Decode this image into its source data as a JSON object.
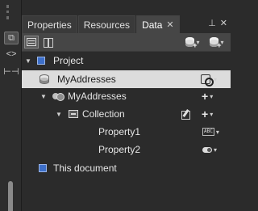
{
  "tabs": [
    {
      "label": "Properties",
      "active": false
    },
    {
      "label": "Resources",
      "active": false
    },
    {
      "label": "Data",
      "active": true
    }
  ],
  "pane_controls": {
    "pin_icon": "pin-icon",
    "close_icon": "close-icon"
  },
  "toolbar": {
    "list_view_icon": "list-view-icon",
    "details_view_icon": "details-view-icon",
    "create_data_source_icon": "database-add-icon",
    "create_sample_data_icon": "database-sample-icon"
  },
  "tree": {
    "project": {
      "label": "Project"
    },
    "data_source": {
      "label": "MyAddresses"
    },
    "dataset": {
      "label": "MyAddresses"
    },
    "collection": {
      "label": "Collection"
    },
    "properties": [
      {
        "label": "Property1",
        "type_icon": "abc-string-icon"
      },
      {
        "label": "Property2",
        "type_icon": "boolean-toggle-icon"
      }
    ],
    "document": {
      "label": "This document"
    }
  },
  "colors": {
    "background": "#2b2b2b",
    "selected_row": "#dcdcdc",
    "project_square": "#3d6fc9"
  }
}
